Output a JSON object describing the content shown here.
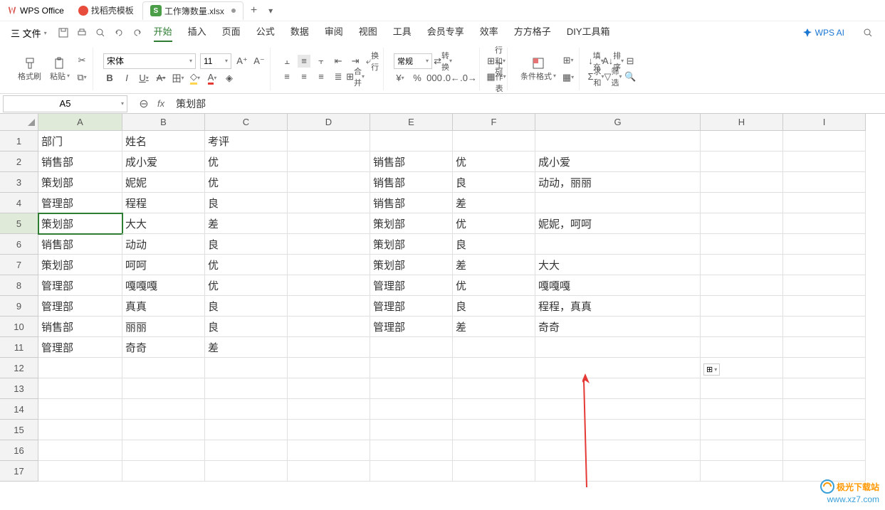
{
  "title_bar": {
    "app_name": "WPS Office",
    "tabs": [
      {
        "label": "找稻壳模板",
        "icon": "fire"
      },
      {
        "label": "工作簿数量.xlsx",
        "icon": "sheet",
        "active": true,
        "modified": true
      }
    ]
  },
  "menu": {
    "file": "三 文件",
    "items": [
      "开始",
      "插入",
      "页面",
      "公式",
      "数据",
      "审阅",
      "视图",
      "工具",
      "会员专享",
      "效率",
      "方方格子",
      "DIY工具箱"
    ],
    "active": "开始",
    "ai": "WPS AI"
  },
  "ribbon": {
    "brush": "格式刷",
    "paste": "粘贴",
    "font_name": "宋体",
    "font_size": "11",
    "format_type": "常规",
    "convert": "转换",
    "wrap": "换行",
    "merge": "合并",
    "rowcol": "行和列",
    "sheet": "工作表",
    "cond_format": "条件格式",
    "fill": "填充",
    "sum": "求和",
    "sort": "排序",
    "filter": "筛选"
  },
  "name_box": "A5",
  "formula_value": "策划部",
  "columns": [
    "A",
    "B",
    "C",
    "D",
    "E",
    "F",
    "G",
    "H",
    "I"
  ],
  "rows": [
    "1",
    "2",
    "3",
    "4",
    "5",
    "6",
    "7",
    "8",
    "9",
    "10",
    "11",
    "12",
    "13",
    "14",
    "15",
    "16",
    "17"
  ],
  "selected_cell": "A5",
  "grid": {
    "1": {
      "A": "部门",
      "B": "姓名",
      "C": "考评"
    },
    "2": {
      "A": "销售部",
      "B": "成小爱",
      "C": "优",
      "E": "销售部",
      "F": "优",
      "G": "成小爱"
    },
    "3": {
      "A": "策划部",
      "B": "妮妮",
      "C": "优",
      "E": "销售部",
      "F": "良",
      "G": "动动，丽丽"
    },
    "4": {
      "A": "管理部",
      "B": "程程",
      "C": "良",
      "E": "销售部",
      "F": "差"
    },
    "5": {
      "A": "策划部",
      "B": "大大",
      "C": "差",
      "E": "策划部",
      "F": "优",
      "G": "妮妮，呵呵"
    },
    "6": {
      "A": "销售部",
      "B": "动动",
      "C": "良",
      "E": "策划部",
      "F": "良"
    },
    "7": {
      "A": "策划部",
      "B": "呵呵",
      "C": "优",
      "E": "策划部",
      "F": "差",
      "G": "大大"
    },
    "8": {
      "A": "管理部",
      "B": "嘎嘎嘎",
      "C": "优",
      "E": "管理部",
      "F": "优",
      "G": "嘎嘎嘎"
    },
    "9": {
      "A": "管理部",
      "B": "真真",
      "C": "良",
      "E": "管理部",
      "F": "良",
      "G": "程程，真真"
    },
    "10": {
      "A": "销售部",
      "B": "丽丽",
      "C": "良",
      "E": "管理部",
      "F": "差",
      "G": "奇奇"
    },
    "11": {
      "A": "管理部",
      "B": "奇奇",
      "C": "差"
    }
  },
  "watermark": {
    "line1": "极光下载站",
    "line2": "www.xz7.com"
  }
}
